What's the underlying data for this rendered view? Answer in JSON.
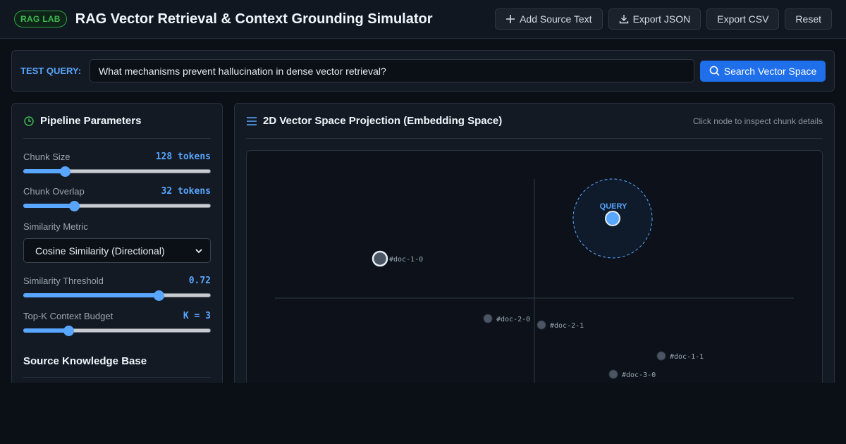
{
  "header": {
    "badge": "RAG LAB",
    "title": "RAG Vector Retrieval & Context Grounding Simulator",
    "actions": {
      "add_source": "Add Source Text",
      "export_json": "Export JSON",
      "export_csv": "Export CSV",
      "reset": "Reset"
    }
  },
  "query": {
    "label": "TEST QUERY:",
    "value": "What mechanisms prevent hallucination in dense vector retrieval?",
    "search_button": "Search Vector Space"
  },
  "parameters": {
    "title": "Pipeline Parameters",
    "chunk_size": {
      "label": "Chunk Size",
      "value_text": "128 tokens",
      "level": 0.22
    },
    "chunk_overlap": {
      "label": "Chunk Overlap",
      "value_text": "32 tokens",
      "level": 0.27
    },
    "similarity_metric": {
      "label": "Similarity Metric",
      "selected": "Cosine Similarity (Directional)"
    },
    "similarity_threshold": {
      "label": "Similarity Threshold",
      "value_text": "0.72",
      "level": 0.72
    },
    "top_k": {
      "label": "Top-K Context Budget",
      "value_text": "K = 3",
      "level": 0.24
    }
  },
  "knowledge_base": {
    "title": "Source Knowledge Base"
  },
  "vector_space": {
    "title": "2D Vector Space Projection (Embedding Space)",
    "hint": "Click node to inspect chunk details",
    "query_label": "QUERY",
    "nodes": [
      {
        "id": "#doc-1-0"
      },
      {
        "id": "#doc-2-0"
      },
      {
        "id": "#doc-2-1"
      },
      {
        "id": "#doc-1-1"
      },
      {
        "id": "#doc-3-0"
      }
    ]
  },
  "colors": {
    "accent": "#58a6ff",
    "brand_green": "#3fb950",
    "primary_button": "#1f6feb"
  }
}
